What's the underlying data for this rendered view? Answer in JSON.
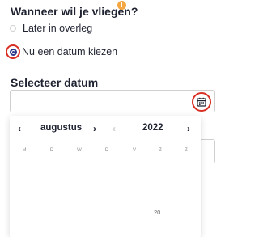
{
  "question": {
    "title": "Wanneer wil je vliegen?",
    "info_badge": "!"
  },
  "options": [
    {
      "label": "Later in overleg",
      "selected": false
    },
    {
      "label": "Nu een datum kiezen",
      "selected": true
    }
  ],
  "date": {
    "label": "Selecteer datum",
    "value": ""
  },
  "datepicker": {
    "month": "augustus",
    "year": "2022",
    "prev_month_icon": "‹",
    "next_month_icon": "›",
    "prev_year_icon": "‹",
    "next_year_icon": "›",
    "weekdays": [
      "M",
      "D",
      "W",
      "D",
      "V",
      "Z",
      "Z"
    ],
    "visible_day": "20"
  },
  "colors": {
    "accent_ring": "#d93025",
    "badge": "#f4a640",
    "radio_selected": "#2d3a8c"
  }
}
